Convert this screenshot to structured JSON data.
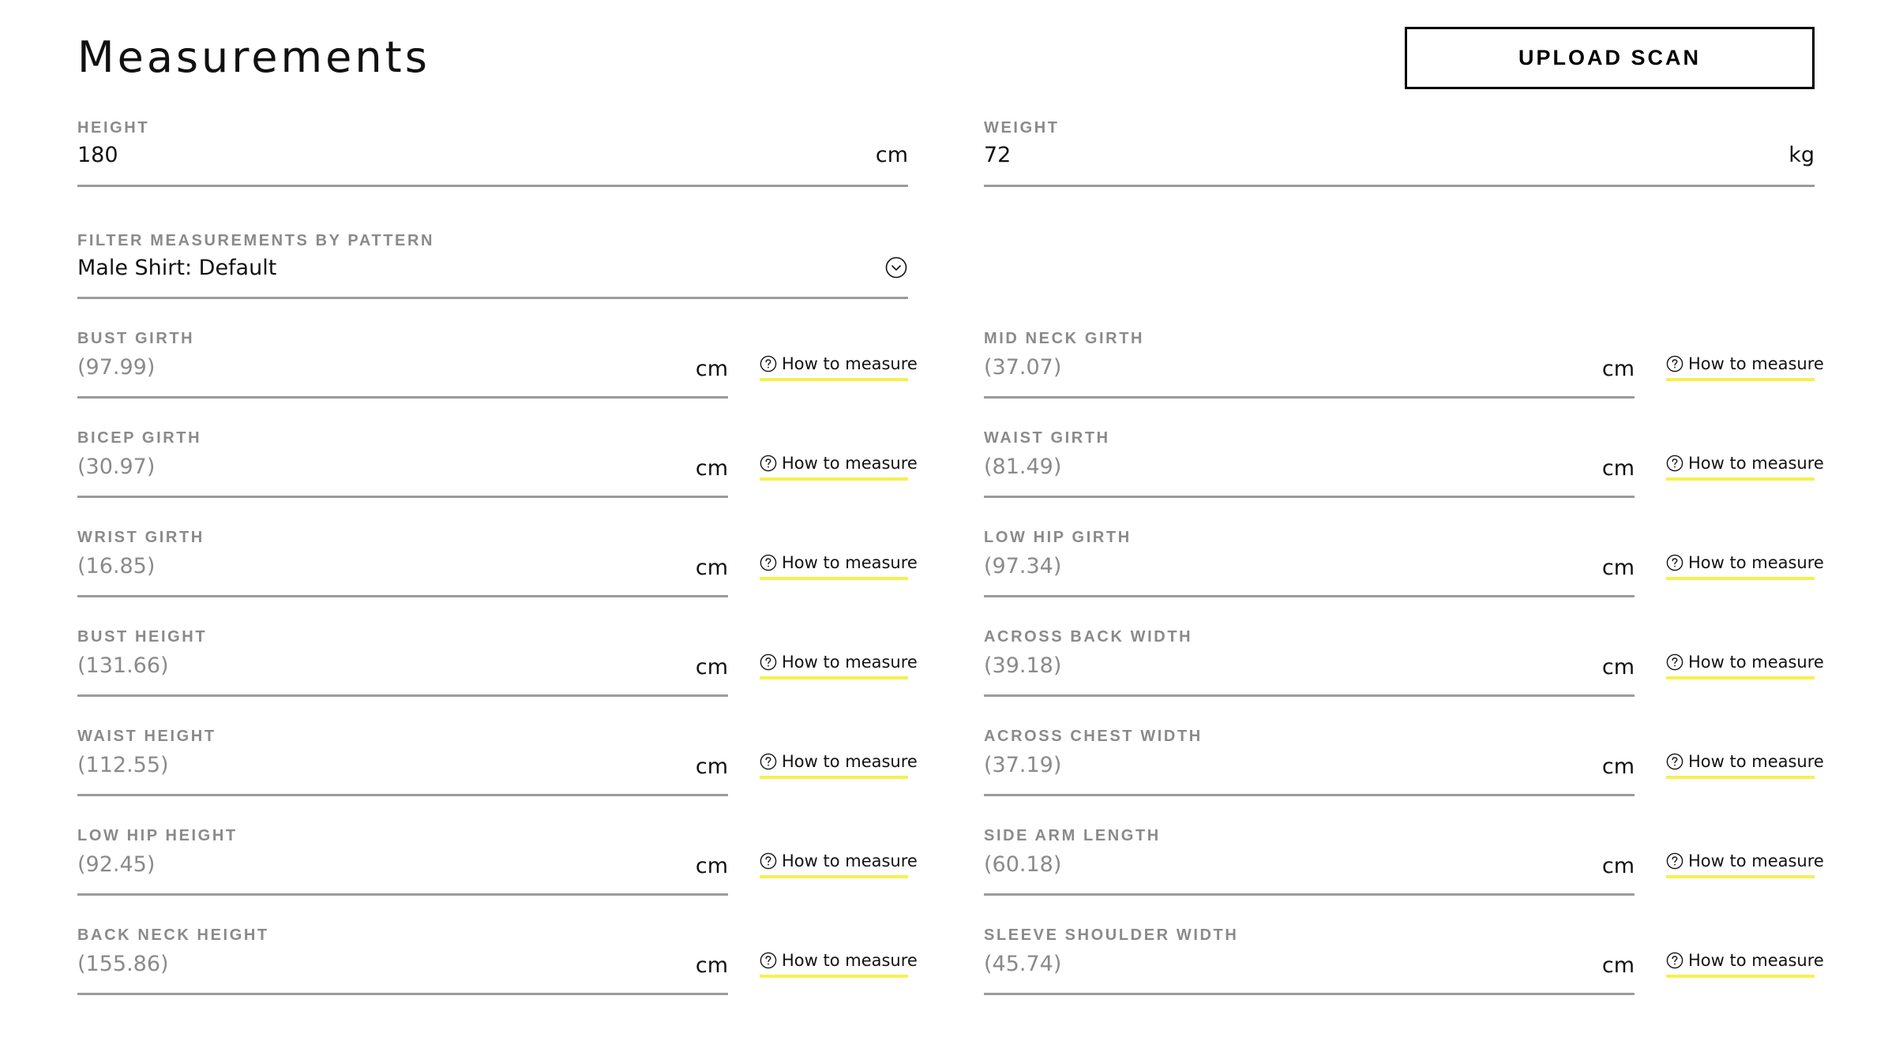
{
  "header": {
    "title": "Measurements",
    "upload_button": "UPLOAD SCAN"
  },
  "basics": {
    "height": {
      "label": "HEIGHT",
      "value": "180",
      "unit": "cm"
    },
    "weight": {
      "label": "WEIGHT",
      "value": "72",
      "unit": "kg"
    }
  },
  "filter": {
    "label": "FILTER MEASUREMENTS BY PATTERN",
    "selected": "Male Shirt: Default",
    "icon": "chevron-down-circle-icon"
  },
  "how_to_label": "How to measure",
  "how_to_icon": "question-circle-icon",
  "accent_color": "#f5f050",
  "measurements": {
    "left": [
      {
        "label": "BUST GIRTH",
        "value": "(97.99)",
        "unit": "cm"
      },
      {
        "label": "BICEP GIRTH",
        "value": "(30.97)",
        "unit": "cm"
      },
      {
        "label": "WRIST GIRTH",
        "value": "(16.85)",
        "unit": "cm"
      },
      {
        "label": "BUST HEIGHT",
        "value": "(131.66)",
        "unit": "cm"
      },
      {
        "label": "WAIST HEIGHT",
        "value": "(112.55)",
        "unit": "cm"
      },
      {
        "label": "LOW HIP HEIGHT",
        "value": "(92.45)",
        "unit": "cm"
      },
      {
        "label": "BACK NECK HEIGHT",
        "value": "(155.86)",
        "unit": "cm"
      }
    ],
    "right": [
      {
        "label": "MID NECK GIRTH",
        "value": "(37.07)",
        "unit": "cm"
      },
      {
        "label": "WAIST GIRTH",
        "value": "(81.49)",
        "unit": "cm"
      },
      {
        "label": "LOW HIP GIRTH",
        "value": "(97.34)",
        "unit": "cm"
      },
      {
        "label": "ACROSS BACK WIDTH",
        "value": "(39.18)",
        "unit": "cm"
      },
      {
        "label": "ACROSS CHEST WIDTH",
        "value": "(37.19)",
        "unit": "cm"
      },
      {
        "label": "SIDE ARM LENGTH",
        "value": "(60.18)",
        "unit": "cm"
      },
      {
        "label": "SLEEVE SHOULDER WIDTH",
        "value": "(45.74)",
        "unit": "cm"
      }
    ]
  }
}
